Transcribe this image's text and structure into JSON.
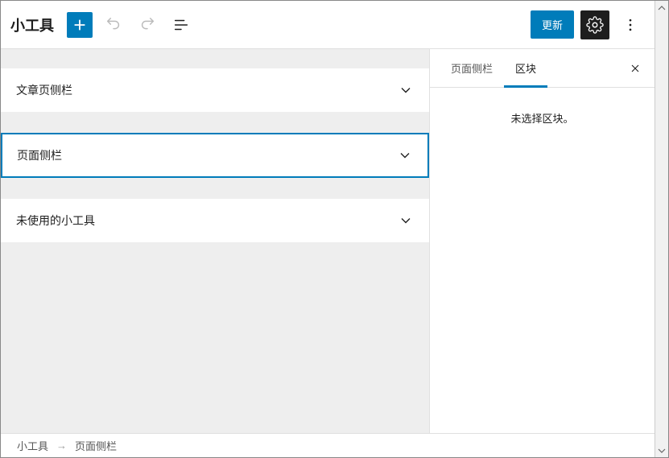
{
  "header": {
    "title": "小工具",
    "update_label": "更新"
  },
  "widget_areas": [
    {
      "label": "文章页侧栏",
      "selected": false
    },
    {
      "label": "页面侧栏",
      "selected": true
    },
    {
      "label": "未使用的小工具",
      "selected": false
    }
  ],
  "sidebar": {
    "tabs": [
      {
        "label": "页面侧栏",
        "active": false
      },
      {
        "label": "区块",
        "active": true
      }
    ],
    "empty_message": "未选择区块。"
  },
  "breadcrumb": {
    "root": "小工具",
    "current": "页面侧栏"
  }
}
